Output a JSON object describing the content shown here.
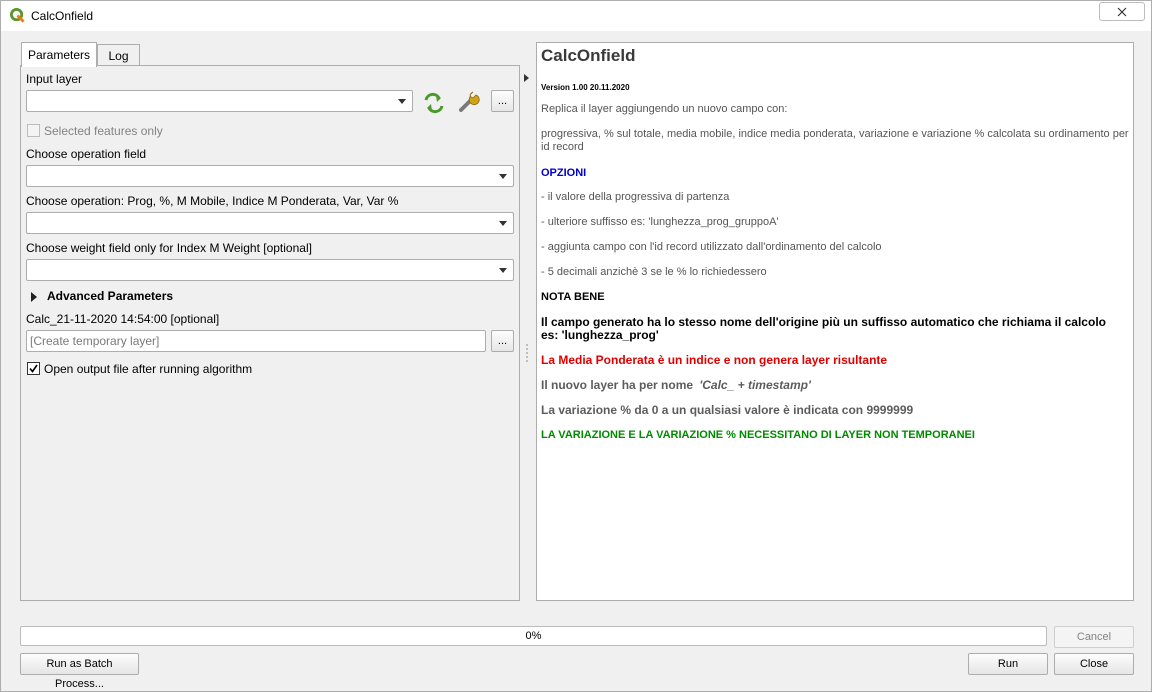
{
  "window": {
    "title": "CalcOnfield"
  },
  "tabs": [
    {
      "label": "Parameters"
    },
    {
      "label": "Log"
    }
  ],
  "params": {
    "input_layer_label": "Input layer",
    "selected_only_label": "Selected features only",
    "operation_field_label": "Choose operation field",
    "operation_label": "Choose operation: Prog, %, M Mobile, Indice M Ponderata, Var, Var %",
    "weight_field_label": "Choose weight field only for Index M Weight [optional]",
    "advanced_label": "Advanced Parameters",
    "output_label": "Calc_21-11-2020 14:54:00 [optional]",
    "output_placeholder": "[Create temporary layer]",
    "open_output_label": "Open output file after running algorithm",
    "open_output_checked": true,
    "dots": "..."
  },
  "help": {
    "title": "CalcOnfield",
    "version": "Version 1.00 20.11.2020",
    "intro": "Replica il layer aggiungendo un nuovo campo con:",
    "fields": "progressiva, % sul totale, media mobile, indice media ponderata, variazione e variazione % calcolata su ordinamento per id record",
    "options_header": "OPZIONI",
    "options": [
      "- il valore della progressiva di partenza",
      "- ulteriore suffisso es: 'lunghezza_prog_gruppoA'",
      "- aggiunta campo con l'id record utilizzato dall'ordinamento del calcolo",
      "- 5 decimali anzichè 3 se le % lo richiedessero"
    ],
    "note_header": "NOTA BENE",
    "note_text": "Il campo generato ha lo stesso nome dell'origine più un suffisso automatico che richiama il calcolo es: 'lunghezza_prog'",
    "red_note": "La Media Ponderata è un indice e non genera layer risultante",
    "name_note_prefix": "Il nuovo layer ha per nome",
    "name_note_italic": "'Calc_ + timestamp'",
    "variation_note": "La variazione % da 0 a un qualsiasi valore è indicata con 9999999",
    "green_note": "LA VARIAZIONE E LA VARIAZIONE % NECESSITANO DI LAYER NON TEMPORANEI"
  },
  "footer": {
    "progress_text": "0%",
    "progress_value": 0,
    "cancel": "Cancel",
    "batch": "Run as Batch Process...",
    "run": "Run",
    "close": "Close"
  }
}
